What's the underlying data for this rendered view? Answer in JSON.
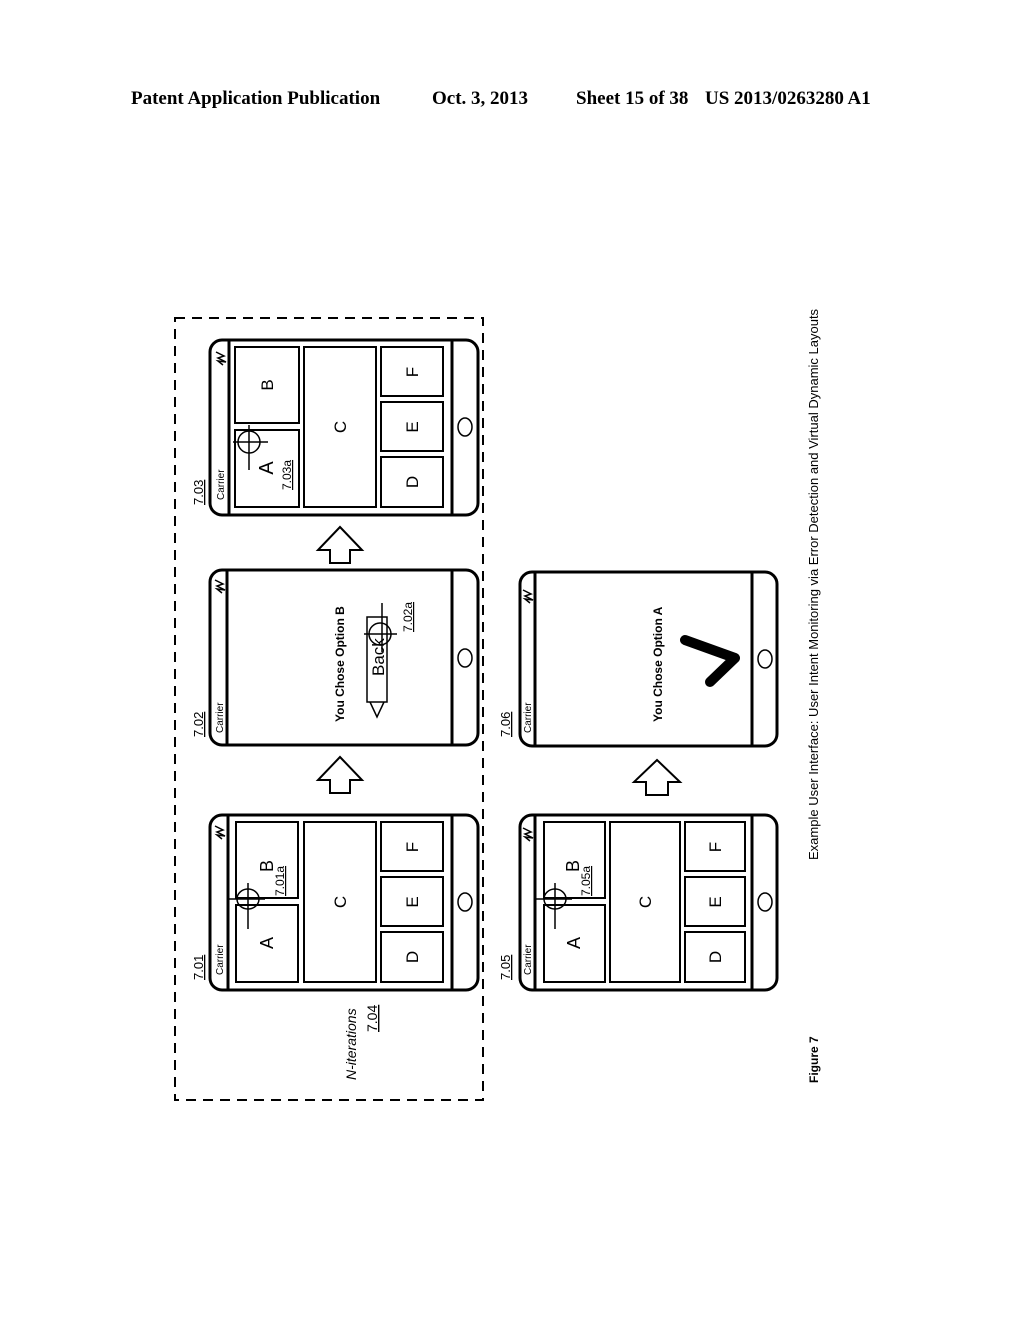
{
  "header": {
    "left": "Patent Application Publication",
    "date": "Oct. 3, 2013",
    "sheet": "Sheet 15 of 38",
    "number": "US 2013/0263280 A1"
  },
  "figure": {
    "label": "Figure 7",
    "caption": "Example User Interface:  User Intent Monitoring via Error Detection and Virtual Dynamic Layouts",
    "loop": {
      "text": "N-iterations",
      "ref": "7.04"
    }
  },
  "phones": {
    "p701": {
      "ref": "7.01",
      "carrier": "Carrier",
      "cells": [
        "A",
        "B",
        "C",
        "D",
        "E",
        "F"
      ],
      "touch_ref": "7.01a"
    },
    "p702": {
      "ref": "7.02",
      "carrier": "Carrier",
      "message": "You Chose Option B",
      "button": "Back",
      "touch_ref": "7.02a"
    },
    "p703": {
      "ref": "7.03",
      "carrier": "Carrier",
      "cells": [
        "A",
        "B",
        "C",
        "D",
        "E",
        "F"
      ],
      "touch_ref": "7.03a"
    },
    "p705": {
      "ref": "7.05",
      "carrier": "Carrier",
      "cells": [
        "A",
        "B",
        "C",
        "D",
        "E",
        "F"
      ],
      "touch_ref": "7.05a"
    },
    "p706": {
      "ref": "7.06",
      "carrier": "Carrier",
      "message": "You Chose Option A",
      "icon": "checkmark-icon"
    }
  }
}
